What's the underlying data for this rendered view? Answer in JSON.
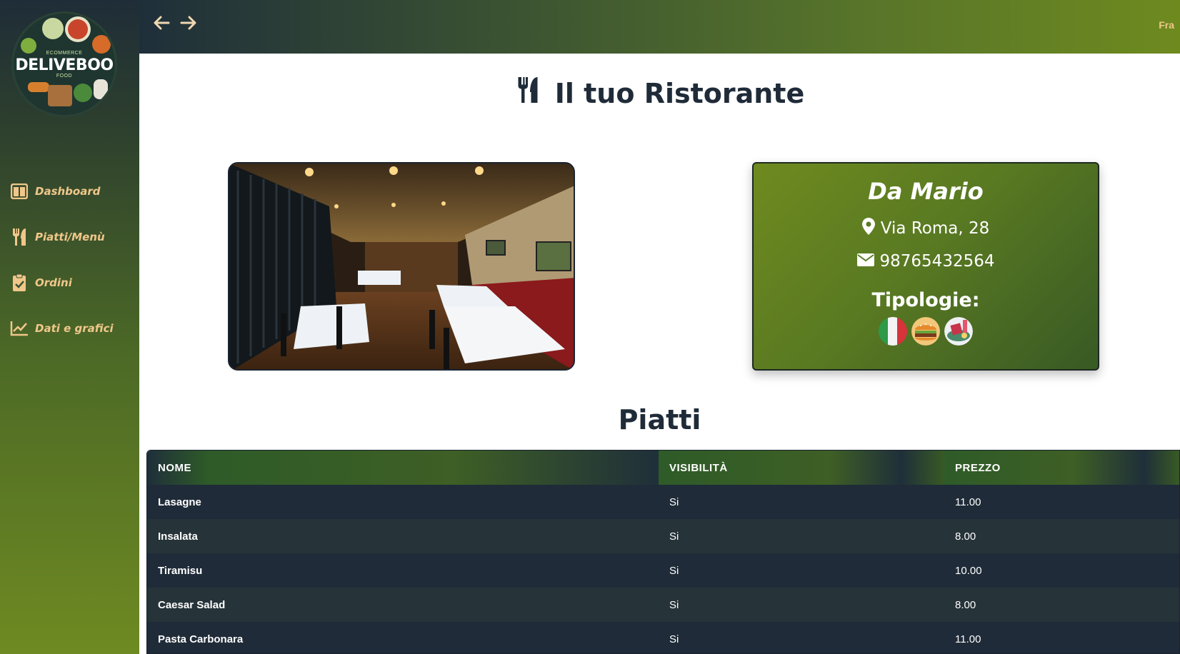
{
  "brand": {
    "name": "DELIVEBOO",
    "top_tag": "ECOMMERCE",
    "bottom_tag": "FOOD"
  },
  "sidebar": {
    "items": [
      {
        "label": "Dashboard",
        "icon": "dashboard-icon"
      },
      {
        "label": "Piatti/Menù",
        "icon": "utensils-icon"
      },
      {
        "label": "Ordini",
        "icon": "clipboard-check-icon"
      },
      {
        "label": "Dati e grafici",
        "icon": "line-chart-icon"
      }
    ]
  },
  "topbar": {
    "back_icon": "arrow-left-icon",
    "forward_icon": "arrow-right-icon",
    "user_label": "Fra"
  },
  "page": {
    "title": "Il tuo Ristorante",
    "title_icon": "utensils-icon"
  },
  "restaurant": {
    "name": "Da Mario",
    "address": "Via Roma, 28",
    "phone": "98765432564",
    "types_label": "Tipologie:",
    "types": [
      "italian-flag-icon",
      "burger-icon",
      "mixed-food-icon"
    ]
  },
  "dishes": {
    "title": "Piatti",
    "columns": [
      "NOME",
      "VISIBILITÀ",
      "PREZZO"
    ],
    "rows": [
      {
        "name": "Lasagne",
        "visible": "Si",
        "price": "11.00"
      },
      {
        "name": "Insalata",
        "visible": "Si",
        "price": "8.00"
      },
      {
        "name": "Tiramisu",
        "visible": "Si",
        "price": "10.00"
      },
      {
        "name": "Caesar Salad",
        "visible": "Si",
        "price": "8.00"
      },
      {
        "name": "Pasta Carbonara",
        "visible": "Si",
        "price": "11.00"
      }
    ]
  },
  "colors": {
    "accent_gold": "#f0c78a",
    "dark_navy": "#1f2b38",
    "olive": "#6e8a1f"
  }
}
